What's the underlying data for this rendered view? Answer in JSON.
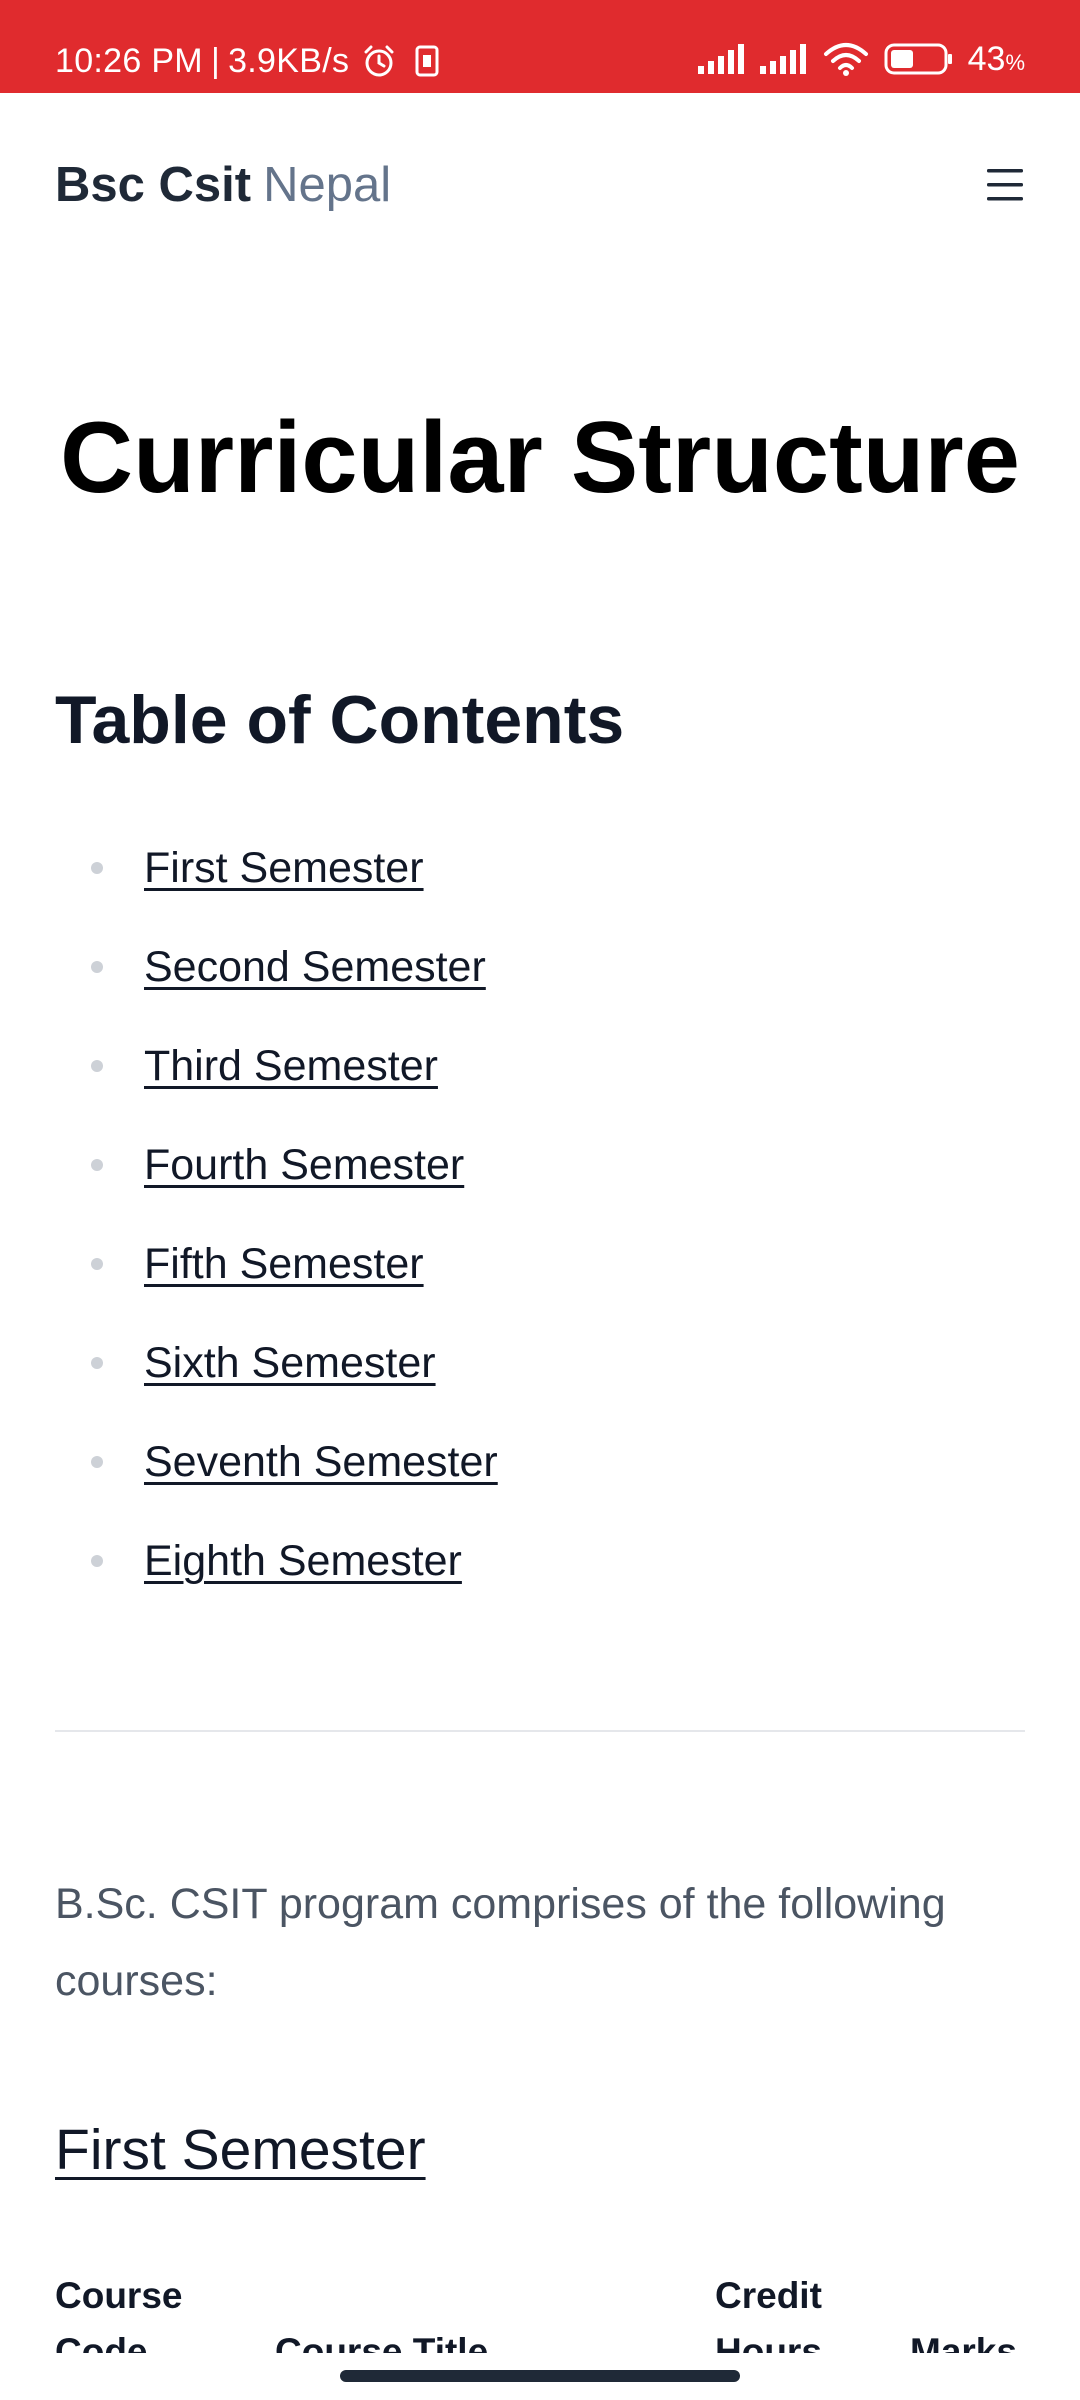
{
  "status_bar": {
    "time": "10:26 PM",
    "separator": "|",
    "network_speed": "3.9KB/s",
    "battery_percent": "43",
    "battery_unit": "%",
    "icons": [
      "alarm-icon",
      "sim-icon",
      "signal-icon",
      "signal-icon",
      "wifi-icon",
      "battery-icon"
    ],
    "battery_level": 0.43,
    "color": "#e02b2e"
  },
  "header": {
    "brand_bold": "Bsc Csit",
    "brand_light": "Nepal",
    "menu_icon": "hamburger-menu-icon"
  },
  "page": {
    "title": "Curricular Structure",
    "toc_heading": "Table of Contents",
    "toc_items": [
      "First Semester",
      "Second Semester",
      "Third Semester",
      "Fourth Semester",
      "Fifth Semester",
      "Sixth Semester",
      "Seventh Semester",
      "Eighth Semester"
    ],
    "intro": "B.Sc. CSIT program comprises of the following courses:",
    "section_heading": "First Semester",
    "table_headers": {
      "col1_line1": "Course",
      "col1_line2": "Code",
      "col2_line2": "Course Title",
      "col3_line1": "Credit",
      "col3_line2": "Hours",
      "col4_line2": "Marks"
    }
  }
}
